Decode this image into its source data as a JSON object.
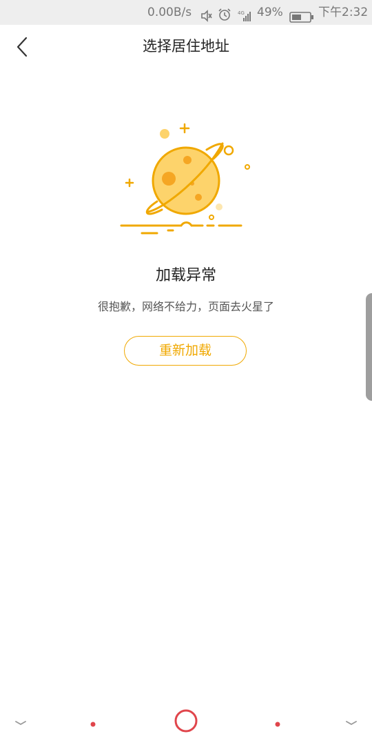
{
  "status_bar": {
    "network_speed": "0.00B/s",
    "network_type": "4G",
    "battery": "49%",
    "time": "下午2:32"
  },
  "header": {
    "title": "选择居住地址"
  },
  "error": {
    "title": "加载异常",
    "description": "很抱歉，网络不给力，页面去火星了",
    "reload_label": "重新加载"
  },
  "icons": {
    "back": "chevron-left-icon",
    "illustration": "planet-illustration",
    "mute": "mute-icon",
    "alarm": "alarm-icon",
    "signal": "signal-icon",
    "battery": "battery-icon",
    "nav_left": "chevron-down-icon",
    "nav_home": "home-circle-icon",
    "nav_right": "chevron-down-icon"
  },
  "colors": {
    "accent": "#f0a800",
    "planet_fill": "#fdd36b",
    "status_bar_bg": "#eeeeee",
    "nav_red": "#e0454b"
  }
}
